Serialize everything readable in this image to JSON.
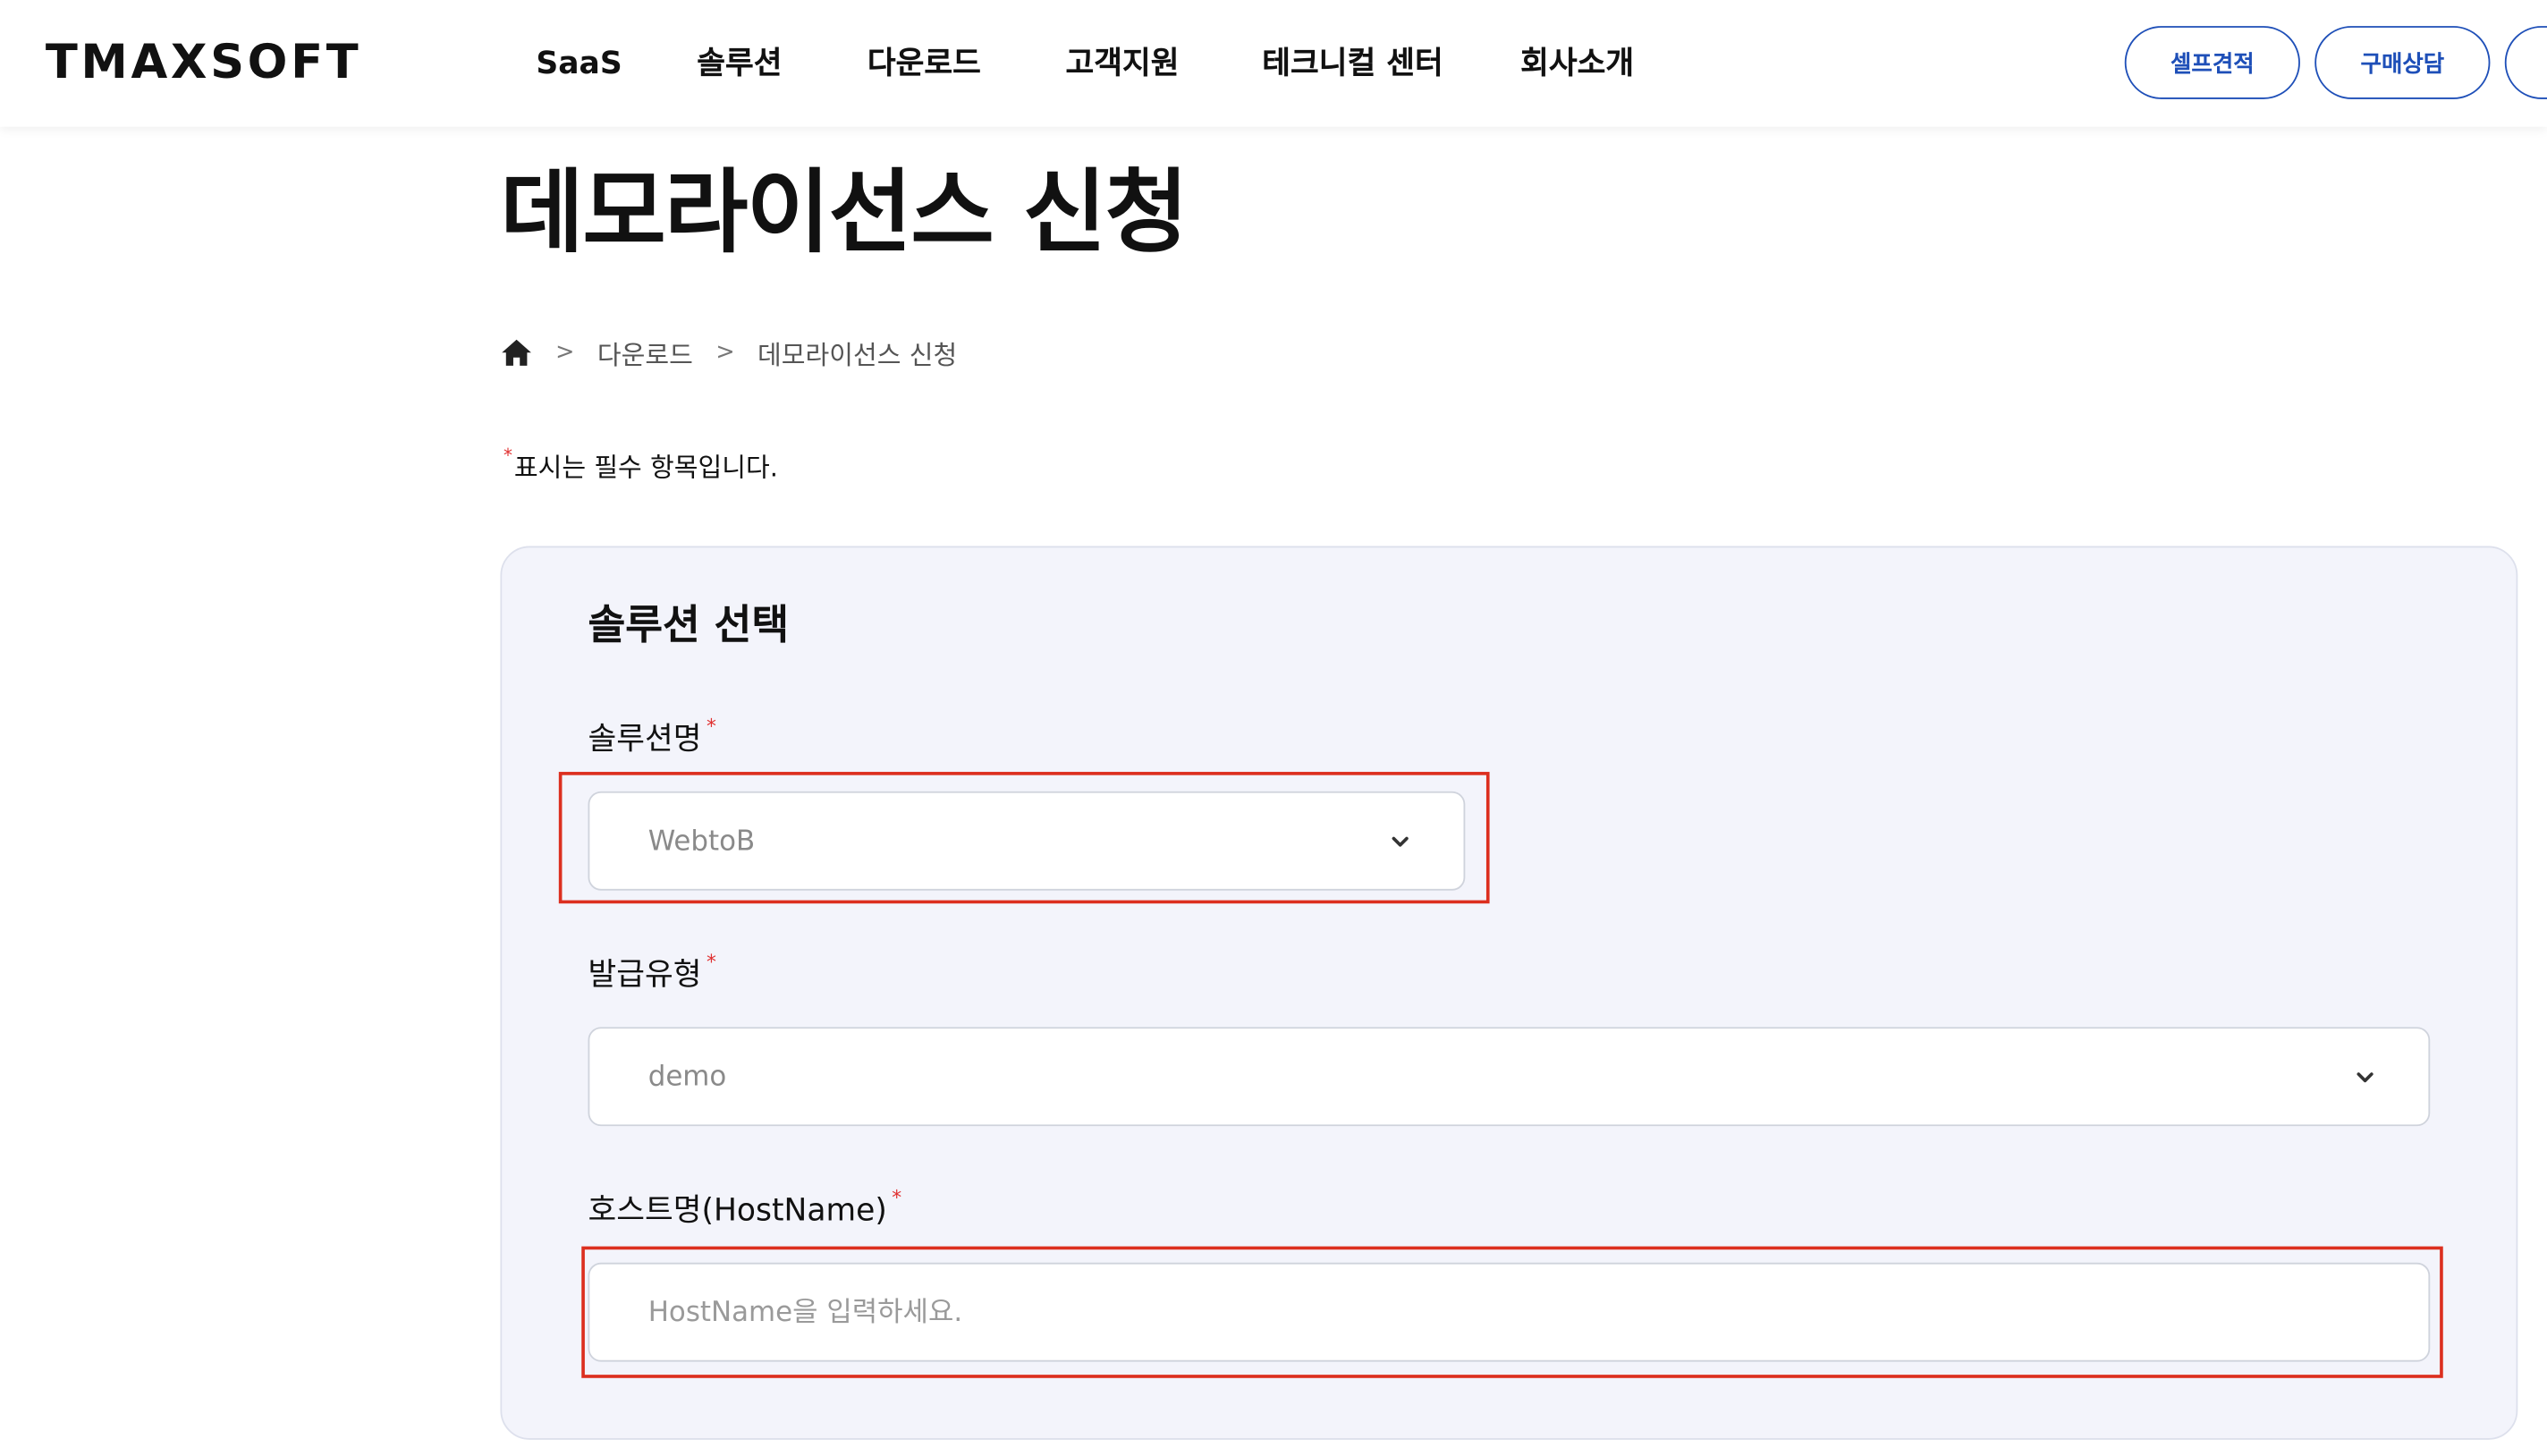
{
  "header": {
    "logo": "TMAXSOFT",
    "nav": [
      "SaaS",
      "솔루션",
      "다운로드",
      "고객지원",
      "테크니컬 센터",
      "회사소개"
    ],
    "buttons": {
      "self_quote": "셀프견적",
      "purchase_consult": "구매상담"
    }
  },
  "page": {
    "title": "데모라이선스 신청",
    "breadcrumb": [
      "다운로드",
      "데모라이선스 신청"
    ],
    "required_note": "표시는 필수 항목입니다.",
    "required_mark": "*"
  },
  "form": {
    "section_title": "솔루션 선택",
    "solution": {
      "label": "솔루션명",
      "value": "WebtoB"
    },
    "issue_type": {
      "label": "발급유형",
      "value": "demo"
    },
    "hostname": {
      "label": "호스트명(HostName)",
      "placeholder": "HostName을 입력하세요."
    }
  },
  "colors": {
    "accent": "#1e4fb8",
    "required": "#e03131",
    "highlight": "#dc2f1f",
    "card_bg": "#f3f4fb"
  },
  "icons": [
    "home-icon",
    "chevron-down-icon"
  ]
}
